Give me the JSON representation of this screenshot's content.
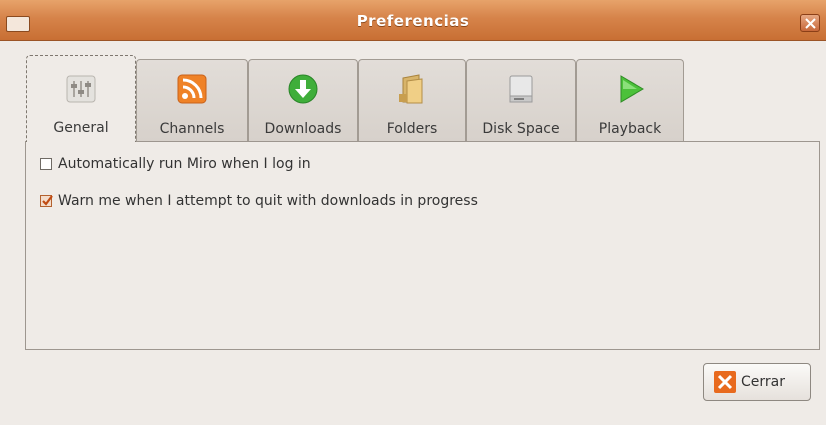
{
  "window": {
    "title": "Preferencias"
  },
  "tabs": [
    {
      "label": "General",
      "icon": "preferences-sliders-icon",
      "active": true
    },
    {
      "label": "Channels",
      "icon": "rss-feed-icon",
      "active": false
    },
    {
      "label": "Downloads",
      "icon": "download-arrow-icon",
      "active": false
    },
    {
      "label": "Folders",
      "icon": "folder-icon",
      "active": false
    },
    {
      "label": "Disk Space",
      "icon": "hard-disk-icon",
      "active": false
    },
    {
      "label": "Playback",
      "icon": "play-icon",
      "active": false
    }
  ],
  "general": {
    "run_on_login": {
      "label": "Automatically run Miro when I log in",
      "checked": false
    },
    "warn_on_quit": {
      "label": "Warn me when I attempt to quit with downloads in progress",
      "checked": true
    }
  },
  "buttons": {
    "close_label": "Cerrar"
  },
  "colors": {
    "titlebar": "#d6834a",
    "accent": "#e86a1e",
    "window_bg": "#efebe7"
  }
}
